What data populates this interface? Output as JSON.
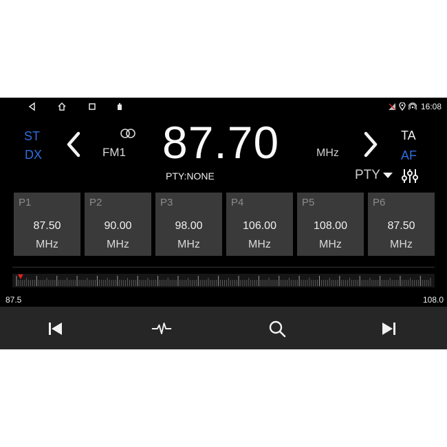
{
  "status": {
    "nav_icons": [
      "back-icon",
      "home-icon",
      "recents-icon",
      "screenshot-icon"
    ],
    "indicators": [
      "no-signal-icon",
      "location-icon",
      "hotspot-icon"
    ],
    "time": "16:08"
  },
  "radio": {
    "st_label": "ST",
    "dx_label": "DX",
    "band": "FM1",
    "frequency": "87.70",
    "unit": "MHz",
    "ta_label": "TA",
    "af_label": "AF",
    "pty_status": "PTY:NONE",
    "pty_button": "PTY"
  },
  "presets": [
    {
      "tag": "P1",
      "value": "87.50",
      "unit": "MHz"
    },
    {
      "tag": "P2",
      "value": "90.00",
      "unit": "MHz"
    },
    {
      "tag": "P3",
      "value": "98.00",
      "unit": "MHz"
    },
    {
      "tag": "P4",
      "value": "106.00",
      "unit": "MHz"
    },
    {
      "tag": "P5",
      "value": "108.00",
      "unit": "MHz"
    },
    {
      "tag": "P6",
      "value": "87.50",
      "unit": "MHz"
    }
  ],
  "tuner": {
    "min_label": "87.5",
    "max_label": "108.0",
    "min": 87.5,
    "max": 108.0,
    "current": 87.7
  },
  "controls": [
    "previous-icon",
    "waveform-icon",
    "search-icon",
    "next-icon"
  ],
  "colors": {
    "accent_blue": "#2f6ee0",
    "indicator_red": "#e02020",
    "preset_bg": "#3a3a3a",
    "control_bar": "#262626"
  }
}
